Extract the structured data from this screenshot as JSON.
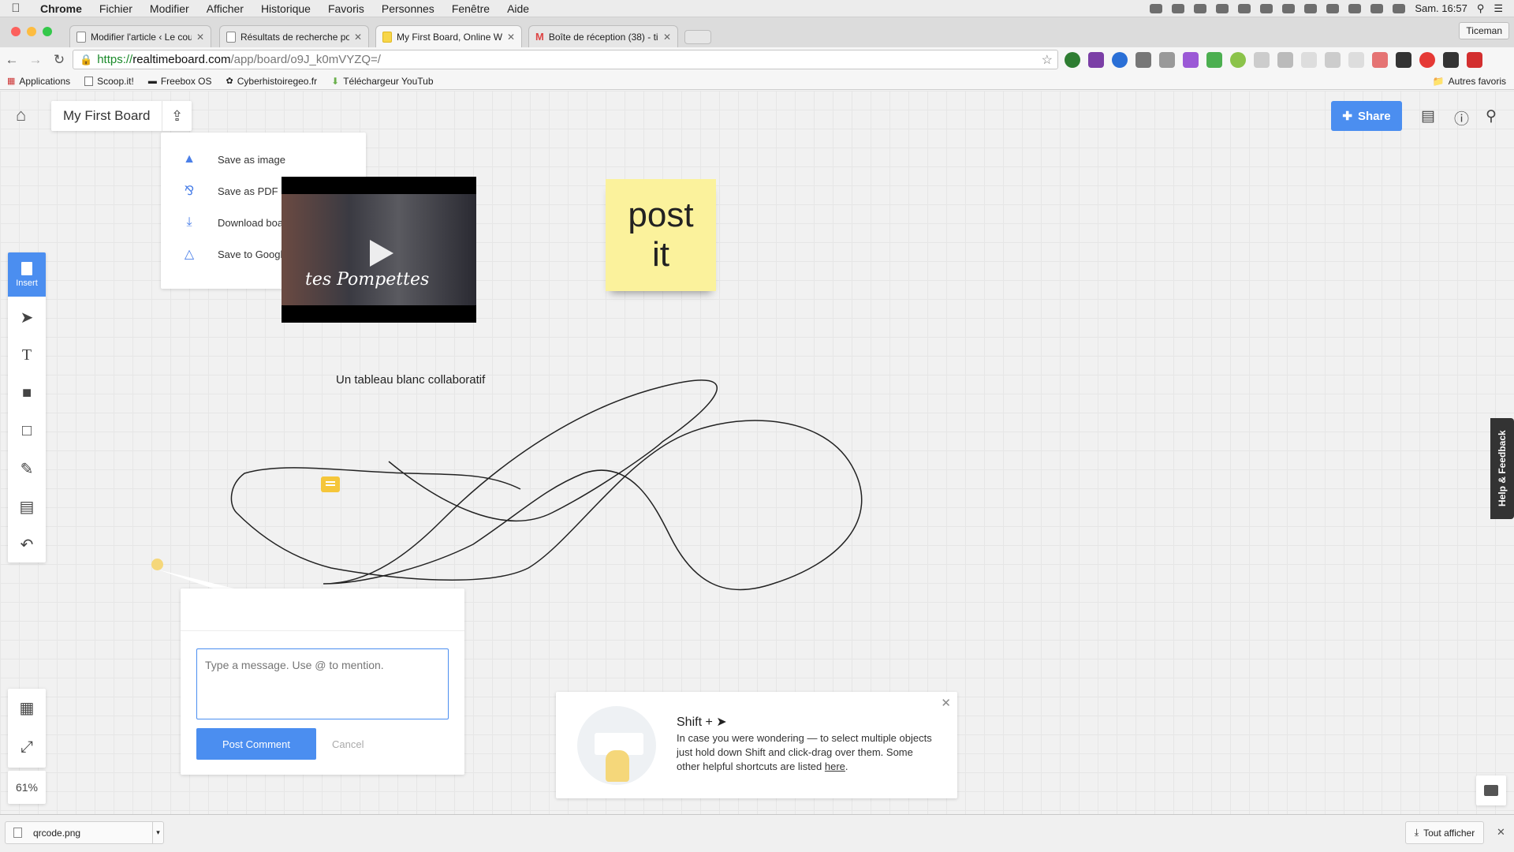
{
  "menubar": {
    "items": [
      "Chrome",
      "Fichier",
      "Modifier",
      "Afficher",
      "Historique",
      "Favoris",
      "Personnes",
      "Fenêtre",
      "Aide"
    ],
    "clock": "Sam. 16:57"
  },
  "tabs": [
    {
      "title": "Modifier l'article ‹ Le coute",
      "active": false
    },
    {
      "title": "Résultats de recherche pou",
      "active": false
    },
    {
      "title": "My First Board, Online Whi",
      "active": true
    },
    {
      "title": "Boîte de réception (38) - ti",
      "active": false
    }
  ],
  "profile_name": "Ticeman",
  "address": {
    "scheme": "https://",
    "host": "realtimeboard.com",
    "path": "/app/board/o9J_k0mVYZQ=/"
  },
  "bookmarks": [
    "Applications",
    "Scoop.it!",
    "Freebox OS",
    "Cyberhistoiregeo.fr",
    "Téléchargeur YouTub"
  ],
  "bookmarks_other": "Autres favoris",
  "board": {
    "title": "My First Board",
    "share_label": "Share",
    "export_menu": [
      {
        "icon": "image-icon",
        "label": "Save as image"
      },
      {
        "icon": "pdf-icon",
        "label": "Save as PDF"
      },
      {
        "icon": "download-icon",
        "label": "Download board backup"
      },
      {
        "icon": "google-drive-icon",
        "label": "Save to GoogleDrive"
      }
    ],
    "insert_label": "Insert",
    "zoom": "61%",
    "video_title": "tes Pompettes",
    "postit_line1": "post",
    "postit_line2": "it",
    "text_item": "Un tableau blanc collaboratif"
  },
  "comment": {
    "placeholder": "Type a message. Use @ to mention.",
    "post_label": "Post Comment",
    "cancel_label": "Cancel"
  },
  "tip": {
    "title": "Shift +",
    "body": "In case you were wondering — to select multiple objects just hold down Shift and click-drag over them. Some other helpful shortcuts are listed ",
    "link": "here",
    "end": "."
  },
  "help_label": "Help & Feedback",
  "download": {
    "file": "qrcode.png",
    "show_all": "Tout afficher"
  },
  "colors": {
    "accent": "#4b8ef0",
    "postit": "#fbf29c",
    "comment_pin": "#f5c63a"
  }
}
